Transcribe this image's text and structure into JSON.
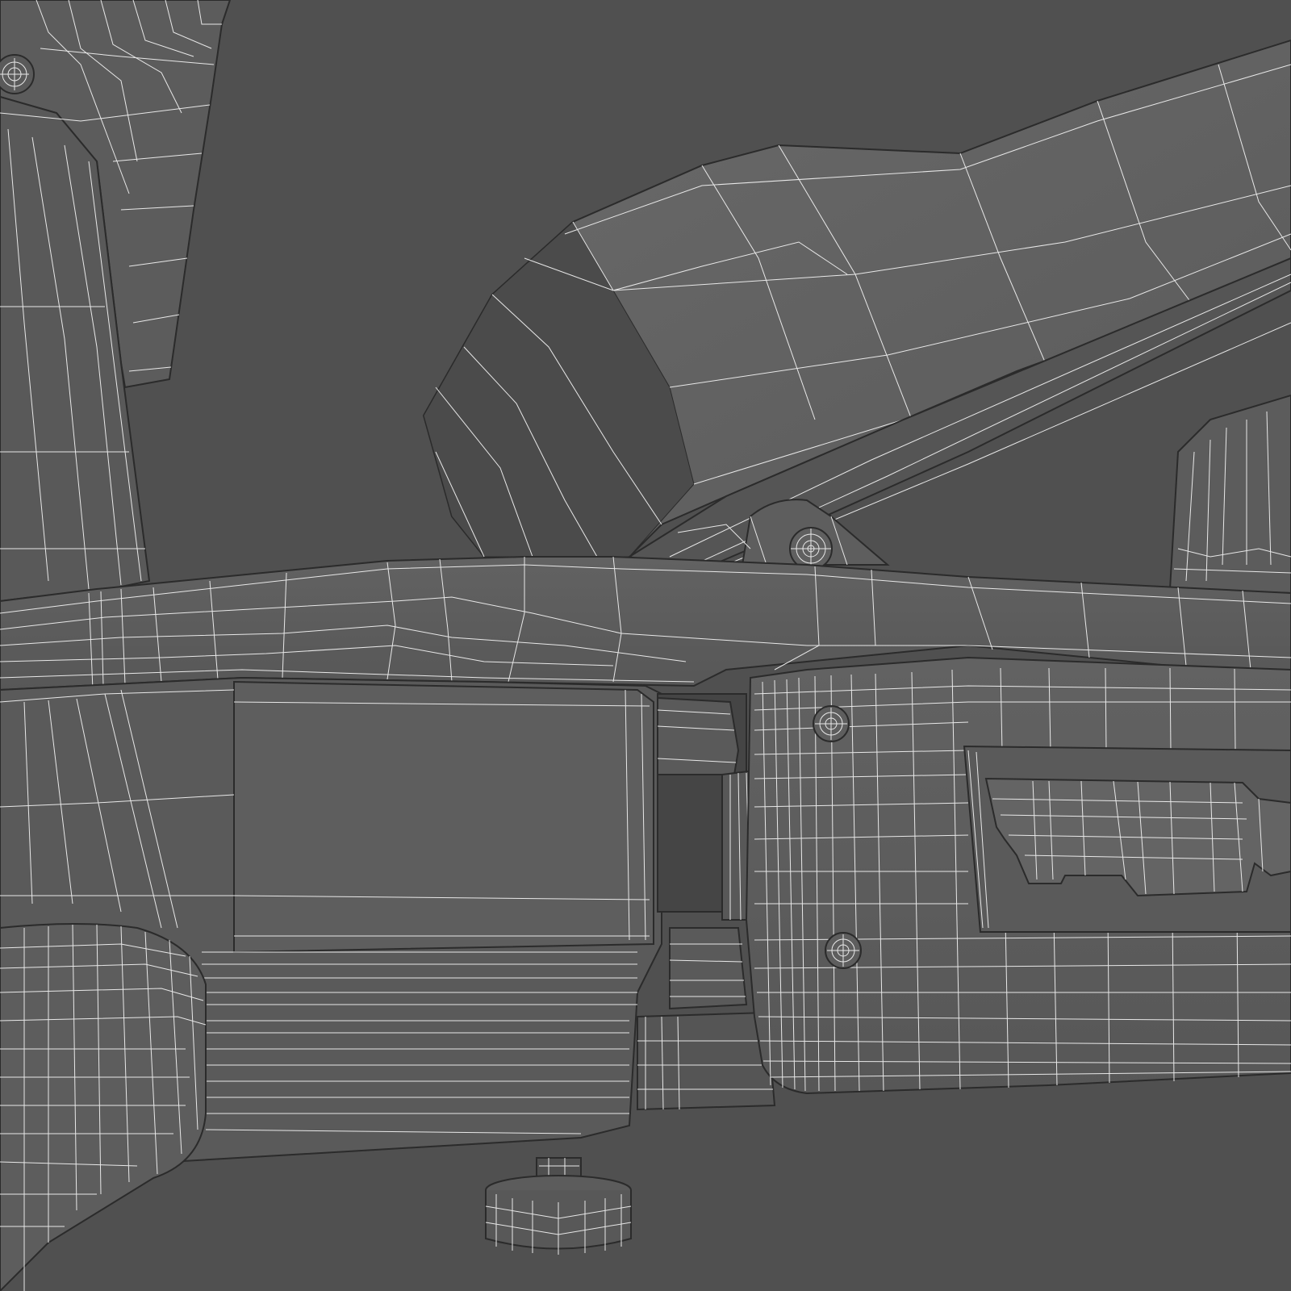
{
  "scene": {
    "subject": "wireframe-3d-render",
    "colors": {
      "background": "#505050",
      "surface": "#5e5e5e",
      "surface_light": "#6b6b6b",
      "surface_dark": "#4a4a4a",
      "edge": "#2a2a2a",
      "wire": "#e8e8e8"
    }
  }
}
